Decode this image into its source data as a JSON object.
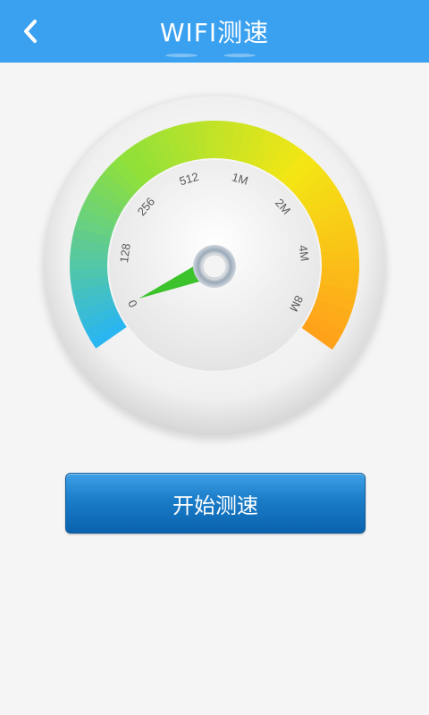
{
  "header": {
    "title": "WIFI测速",
    "back_icon": "chevron-left-icon",
    "background_color": "#3aa0f0"
  },
  "gauge": {
    "tick_labels": [
      "0",
      "128",
      "256",
      "512",
      "1M",
      "2M",
      "4M",
      "8M"
    ],
    "current_value": "0",
    "colors": {
      "low": "#2ab6f0",
      "mid": "#8ee03a",
      "high": "#ffa21a",
      "needle": "#3cc22a"
    }
  },
  "actions": {
    "start_label": "开始测速"
  }
}
